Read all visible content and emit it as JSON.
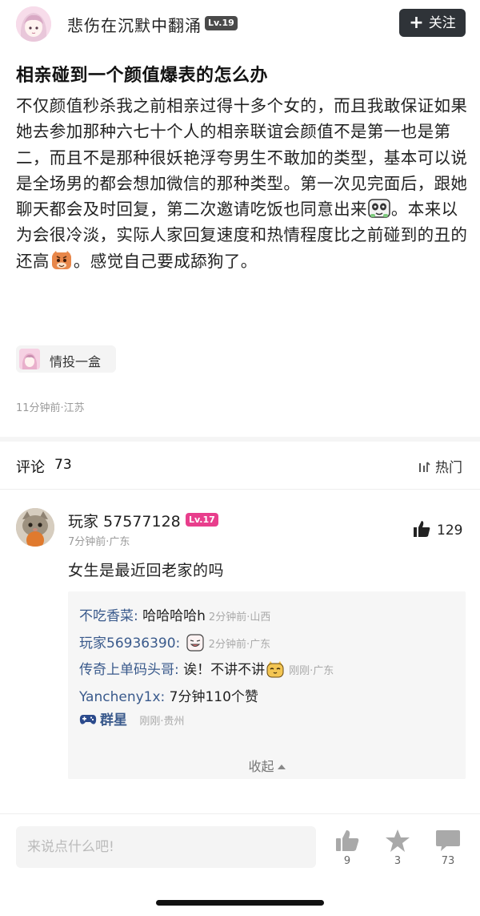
{
  "header": {
    "author_name": "悲伤在沉默中翻涌",
    "level": "Lv.19",
    "follow_label": "关注"
  },
  "post": {
    "title": "相亲碰到一个颜值爆表的怎么办",
    "body_1": "不仅颜值秒杀我之前相亲过得十多个女的，而且我敢保证如果她去参加那种六七十个人的相亲联谊会颜值不是第一也是第二，而且不是那种很妖艳浮夸男生不敢加的类型，基本可以说是全场男的都会想加微信的那种类型。第一次见完面后，跟她聊天都会及时回复，第二次邀请吃饭也同意出来",
    "body_2": "。本来以为会很冷淡，实际人家回复速度和热情程度比之前碰到的丑的还高",
    "body_3": "。感觉自己要成舔狗了。",
    "tag": "情投一盒",
    "meta": "11分钟前·江苏"
  },
  "comments_header": {
    "label": "评论",
    "count": "73",
    "sort_label": "热门"
  },
  "comment": {
    "user": "玩家 57577128",
    "level": "Lv.17",
    "meta": "7分钟前·广东",
    "likes": "129",
    "text": "女生是最近回老家的吗",
    "replies": [
      {
        "name": "不吃香菜",
        "sep": ":",
        "text": "哈哈哈哈h",
        "meta": "2分钟前·山西"
      },
      {
        "name": "玩家56936390",
        "sep": ":",
        "text": "",
        "meta": "2分钟前·广东"
      },
      {
        "name": "传奇上单码头哥",
        "sep": ":",
        "text": "诶！不讲不讲",
        "meta": "刚刚·广东"
      },
      {
        "name": "Yancheny1x",
        "sep": ":",
        "text": "7分钟110个赞",
        "meta": ""
      },
      {
        "name": "群星",
        "sep": "",
        "text": "",
        "meta": "刚刚·贵州"
      }
    ],
    "collapse_label": "收起"
  },
  "bottom_bar": {
    "input_placeholder": "来说点什么吧!",
    "like_count": "9",
    "star_count": "3",
    "comment_count": "73"
  },
  "colors": {
    "accent_follow": "#2f3338",
    "level_badge_pink": "#e83e8c",
    "reply_name": "#3a5a8c"
  },
  "icons": [
    "plus-icon",
    "sort-icon",
    "thumb-up-icon",
    "star-icon",
    "comment-icon",
    "gamepad-icon",
    "panda-emoji",
    "tiger-emoji",
    "grin-emoji",
    "cat-emoji",
    "triangle-up-icon"
  ]
}
